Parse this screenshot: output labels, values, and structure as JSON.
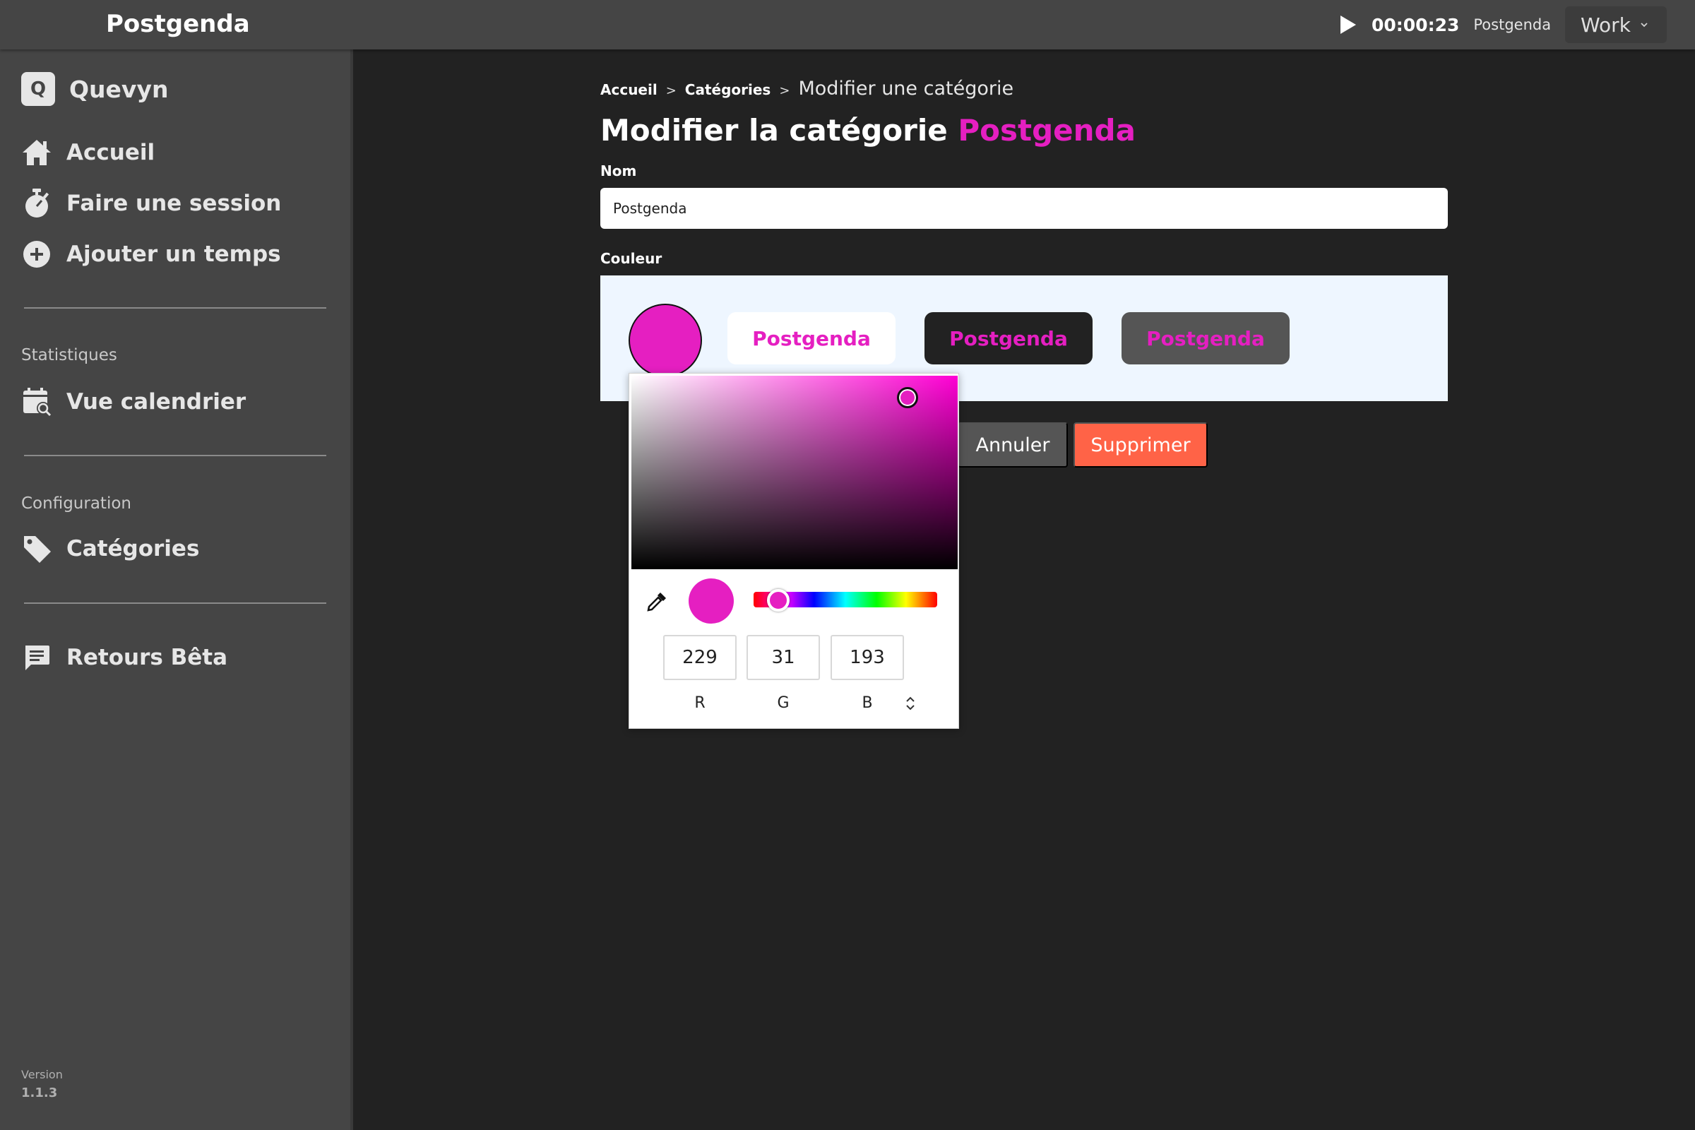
{
  "topbar": {
    "app_title": "Postgenda",
    "timer": "00:00:23",
    "current_category": "Postgenda",
    "workspace": "Work"
  },
  "sidebar": {
    "org_initial": "Q",
    "org_name": "Quevyn",
    "nav": {
      "home": "Accueil",
      "session": "Faire une session",
      "add_time": "Ajouter un temps"
    },
    "stats_section": "Statistiques",
    "calendar": "Vue calendrier",
    "config_section": "Configuration",
    "categories": "Catégories",
    "feedback": "Retours Bêta",
    "version_label": "Version",
    "version": "1.1.3"
  },
  "breadcrumb": {
    "home": "Accueil",
    "categories": "Catégories",
    "current": "Modifier une catégorie",
    "separator": ">"
  },
  "page": {
    "title_prefix": "Modifier la catégorie",
    "title_name": "Postgenda",
    "name_label": "Nom",
    "name_value": "Postgenda",
    "color_label": "Couleur",
    "preview_text": "Postgenda",
    "cancel_label": "Annuler",
    "delete_label": "Supprimer"
  },
  "color_picker": {
    "r": "229",
    "g": "31",
    "b": "193",
    "label_r": "R",
    "label_g": "G",
    "label_b": "B",
    "hex": "#e51fc1"
  },
  "colors": {
    "accent": "#e51fc1",
    "danger": "#ff6347",
    "sidebar_bg": "#454545",
    "main_bg": "#222222"
  }
}
